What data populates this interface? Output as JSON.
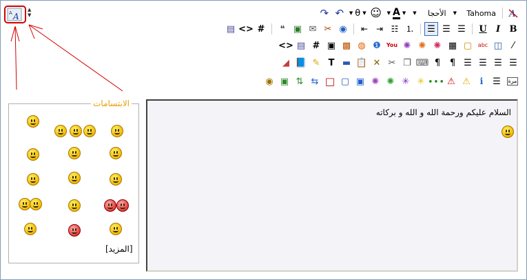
{
  "toolbar": {
    "font_name": "Tahoma",
    "font_size_label": "الأحجا"
  },
  "editor": {
    "content_text": "السلام عليكم  ورحمة الله و الله و بركاته"
  },
  "smilies_panel": {
    "title": "الابتسامات",
    "more_link": "[المزيد]"
  },
  "annotation": {
    "highlight_color": "#d40000"
  }
}
